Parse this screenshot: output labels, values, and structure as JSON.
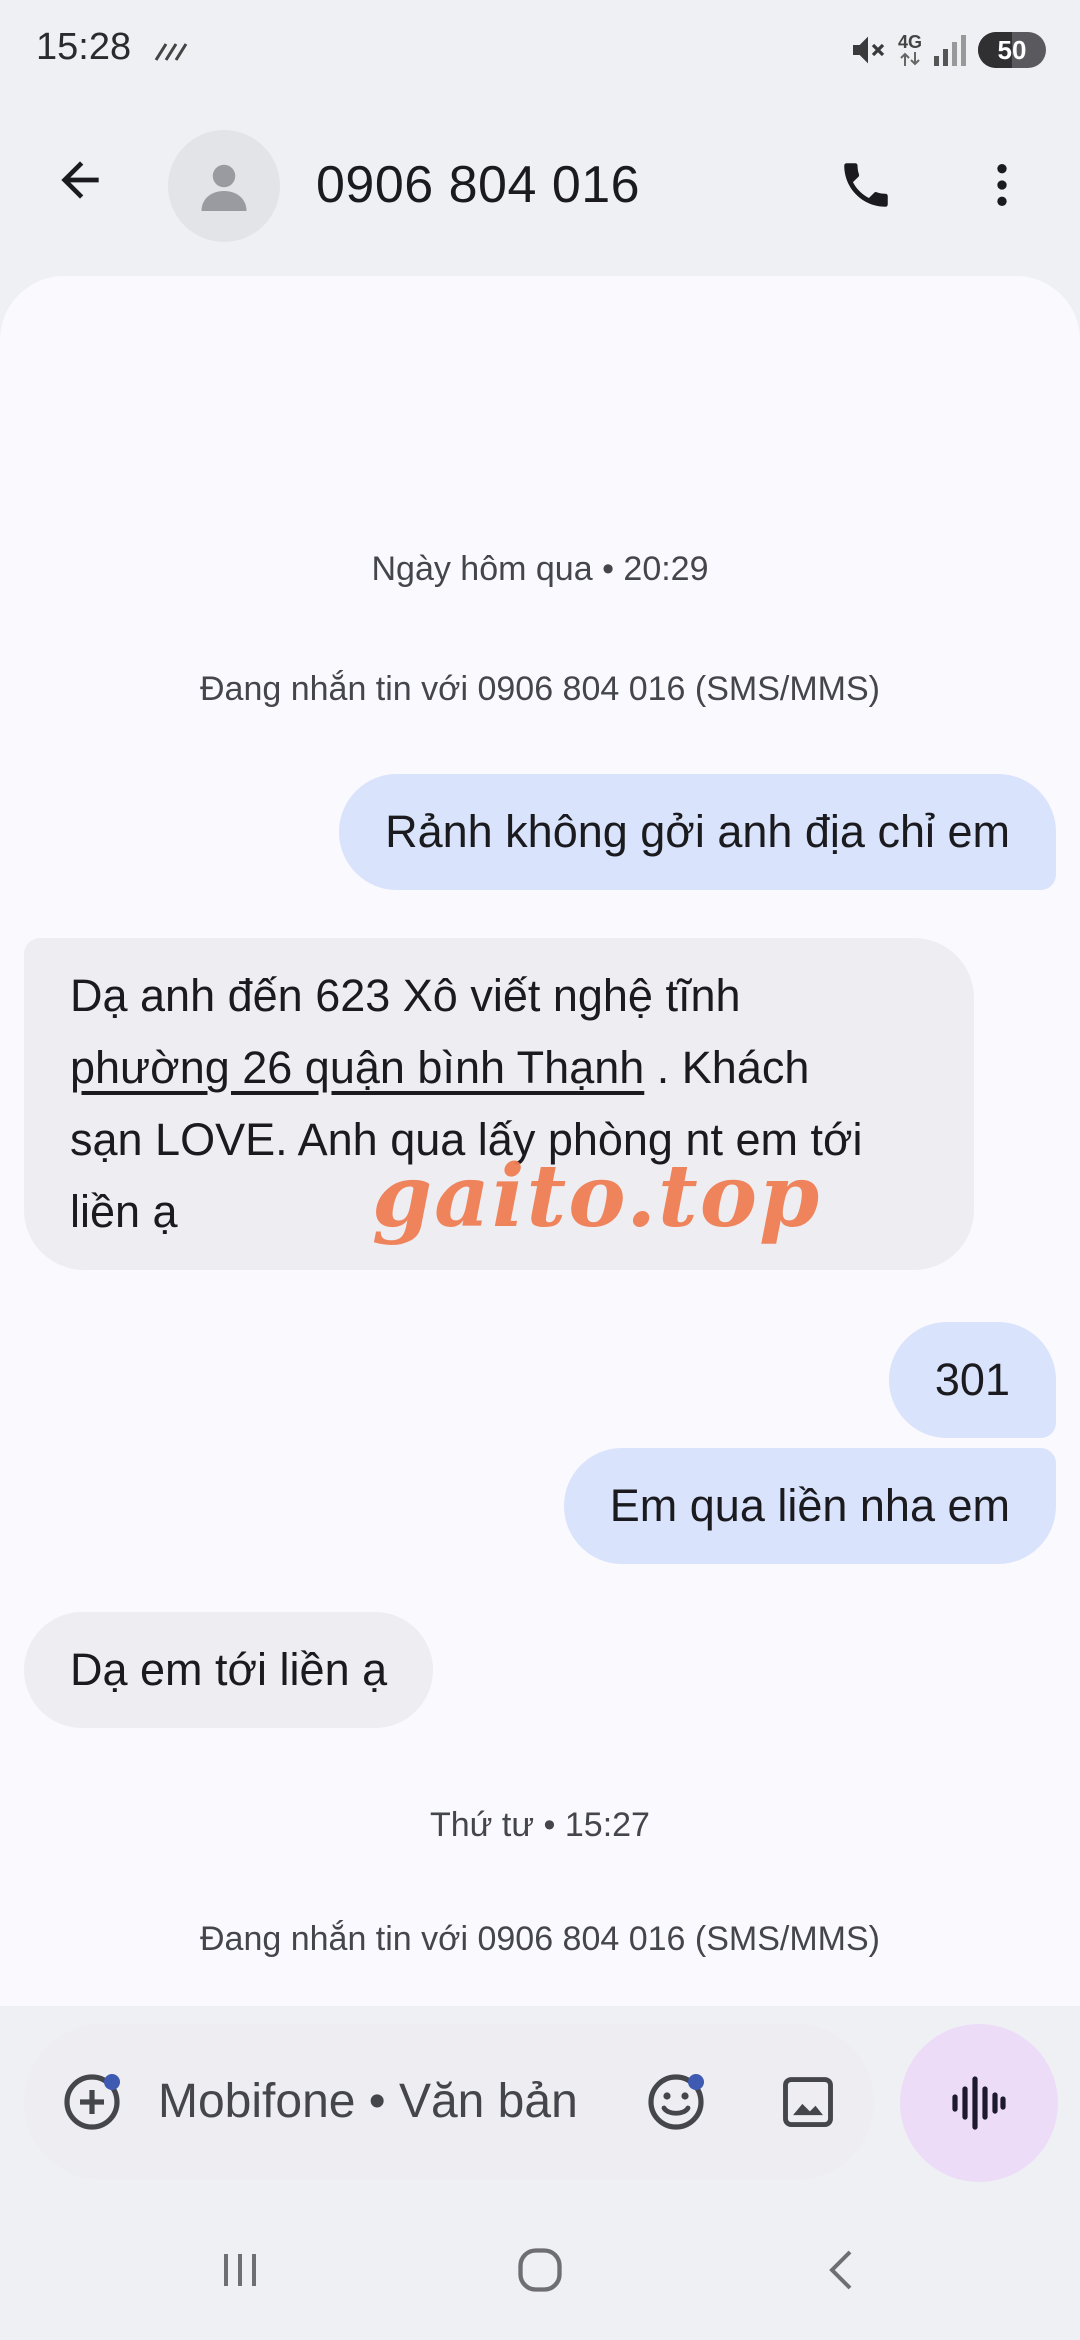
{
  "status_bar": {
    "time": "15:28",
    "network": "4G",
    "battery": "50",
    "battery_level": 0.5
  },
  "header": {
    "contact": "0906 804 016",
    "icons": [
      "back-arrow-icon",
      "person-icon",
      "phone-icon",
      "more-vert-icon"
    ]
  },
  "conversation": {
    "date_1": "Ngày hôm qua • 20:29",
    "info_1": "Đang nhắn tin với 0906 804 016 (SMS/MMS)",
    "messages": [
      {
        "direction": "out",
        "text": "Rảnh không gởi anh địa chỉ em"
      },
      {
        "direction": "in",
        "line1": "Dạ anh đến 623 Xô viết nghệ tĩnh",
        "link": "phường 26 quận bình Thạnh",
        "line2_rest": " . Khách",
        "line3": "sạn LOVE. Anh qua lấy phòng nt em tới",
        "line4": "liền ạ"
      },
      {
        "direction": "out",
        "text": "301"
      },
      {
        "direction": "out",
        "text": "Em qua liền nha em"
      },
      {
        "direction": "in",
        "text": "Dạ em tới liền ạ"
      }
    ],
    "date_2": "Thứ tư • 15:27",
    "info_2": "Đang nhắn tin với 0906 804 016 (SMS/MMS)"
  },
  "watermark": "gaito.top",
  "composer": {
    "placeholder": "Mobifone • Văn bản",
    "icons": [
      "add-attachment-icon",
      "emoji-icon",
      "gallery-icon",
      "voice-message-icon"
    ]
  },
  "colors": {
    "outgoing_bubble": "#d9e3fb",
    "incoming_bubble": "#eeeef2",
    "mic_button": "#ecdcf8",
    "watermark": "#f07f55"
  }
}
